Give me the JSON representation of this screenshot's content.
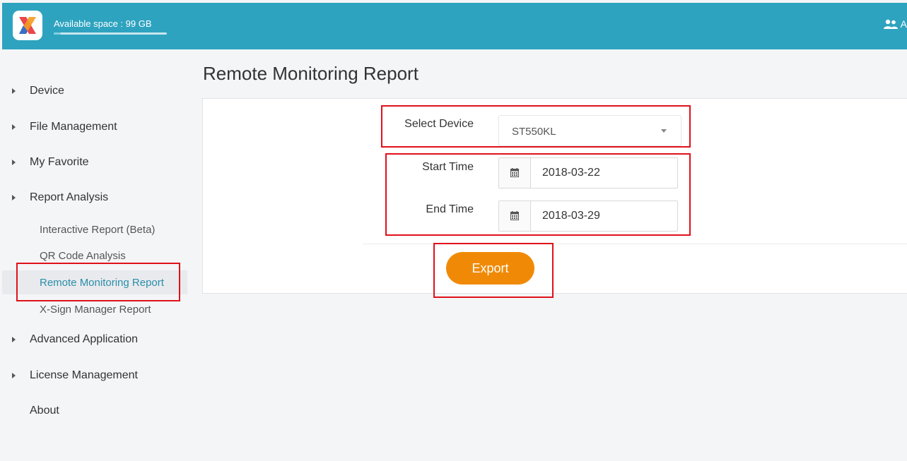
{
  "header": {
    "available_space": "Available space : 99 GB",
    "space_used_fraction": 0.06,
    "user_text": "A",
    "accent_color": "#2ea3bf"
  },
  "sidebar": {
    "items": [
      {
        "label": "Device",
        "icon": "caret-right-icon"
      },
      {
        "label": "File Management",
        "icon": "caret-right-icon"
      },
      {
        "label": "My Favorite",
        "icon": "caret-right-icon"
      },
      {
        "label": "Report Analysis",
        "icon": "caret-right-icon"
      },
      {
        "label": "Advanced Application",
        "icon": "caret-right-icon"
      },
      {
        "label": "License Management",
        "icon": "caret-right-icon"
      },
      {
        "label": "About"
      }
    ],
    "report_sub_items": [
      {
        "label": "Interactive Report (Beta)"
      },
      {
        "label": "QR Code Analysis"
      },
      {
        "label": "Remote Monitoring Report",
        "active": true
      },
      {
        "label": "X-Sign Manager Report"
      }
    ],
    "active_color": "#2a8eab"
  },
  "main": {
    "title": "Remote Monitoring Report",
    "select_device_label": "Select Device",
    "select_device_value": "ST550KL",
    "start_time_label": "Start Time",
    "start_time_value": "2018-03-22",
    "end_time_label": "End Time",
    "end_time_value": "2018-03-29",
    "export_label": "Export",
    "export_color": "#f08a06",
    "highlight_color": "#e0111a"
  }
}
